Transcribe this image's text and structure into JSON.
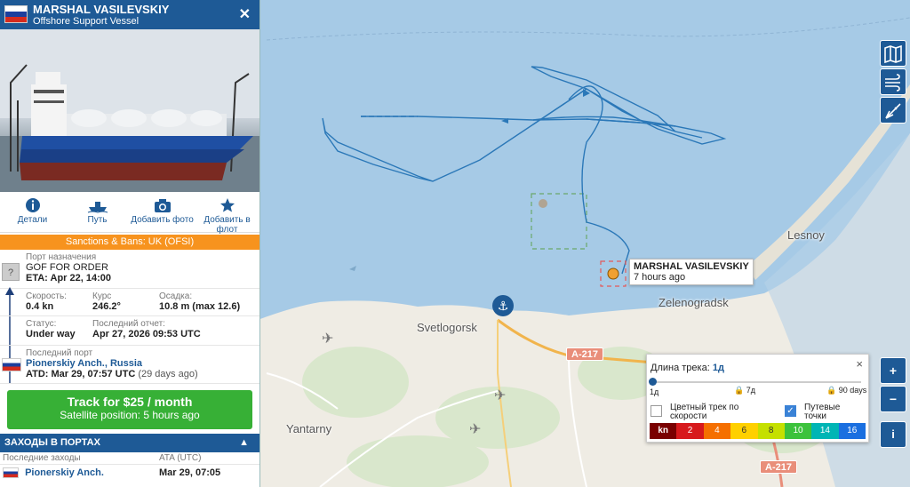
{
  "vessel": {
    "name": "MARSHAL VASILEVSKIY",
    "type": "Offshore Support Vessel",
    "close_icon": "close-icon"
  },
  "actions": [
    {
      "label": "Детали",
      "icon": "info-icon"
    },
    {
      "label": "Путь",
      "icon": "ship-path-icon"
    },
    {
      "label": "Добавить фото",
      "icon": "camera-icon"
    },
    {
      "label": "Добавить в флот",
      "icon": "star-icon"
    }
  ],
  "sanctions": "Sanctions & Bans: UK (OFSI)",
  "destination": {
    "label": "Порт назначения",
    "value": "GOF FOR ORDER",
    "eta": "ETA: Apr 22, 14:00",
    "unknown_mark": "?"
  },
  "nav": {
    "speed_label": "Скорость:",
    "speed": "0.4 kn",
    "course_label": "Курс",
    "course": "246.2°",
    "draught_label": "Осадка:",
    "draught": "10.8 m (max 12.6)",
    "status_label": "Статус:",
    "status": "Under way",
    "report_label": "Последний отчет:",
    "report": "Apr 27, 2026 09:53 UTC"
  },
  "last_port": {
    "label": "Последний порт",
    "name": "Pionerskiy Anch., Russia",
    "atd": "ATD: Mar 29, 07:57 UTC",
    "ago": "(29 days ago)"
  },
  "track_button": {
    "title": "Track for $25 / month",
    "subtitle": "Satellite position: 5 hours ago"
  },
  "port_calls": {
    "header": "ЗАХОДЫ В ПОРТАХ",
    "col_recent": "Последние заходы",
    "col_ata": "ATA (UTC)",
    "rows": [
      {
        "port": "Pionerskiy Anch.",
        "ata": "Mar 29, 07:05"
      }
    ]
  },
  "map": {
    "labels": {
      "svetlogorsk": "Svetlogorsk",
      "zelenogradsk": "Zelenogradsk",
      "lesnoy": "Lesnoy",
      "yantarny": "Yantarny"
    },
    "roads": [
      "A-217",
      "A-217"
    ],
    "vessel_tag": {
      "name": "MARSHAL VASILEVSKIY",
      "ago": "7 hours ago"
    },
    "controls": [
      "map-layers-icon",
      "weather-icon",
      "measure-icon"
    ],
    "zoom_in": "+",
    "zoom_out": "−",
    "info": "i"
  },
  "track_legend": {
    "title": "Длина трека:",
    "selected": "1д",
    "marks": [
      "1д",
      "7д",
      "90 days"
    ],
    "color_by_speed": "Цветный трек по скорости",
    "waypoints": "Путевые точки",
    "speed_unit": "kn",
    "speed_steps": [
      "2",
      "4",
      "6",
      "8",
      "10",
      "14",
      "16"
    ],
    "speed_colors": [
      "#7a0000",
      "#d7191c",
      "#f56f00",
      "#ffd000",
      "#c5e000",
      "#3cc23c",
      "#00b5b5",
      "#1a6fe0"
    ],
    "close": "×"
  }
}
